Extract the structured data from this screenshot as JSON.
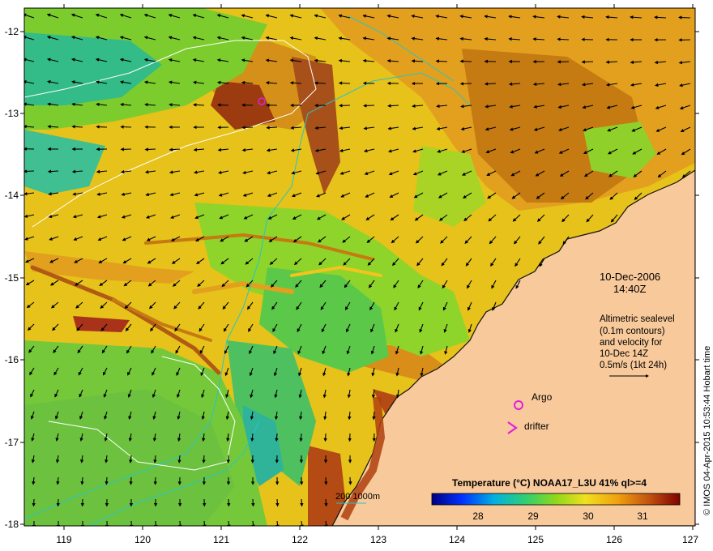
{
  "map": {
    "lon_ticks": [
      "119",
      "120",
      "121",
      "122",
      "123",
      "124",
      "125",
      "126",
      "127"
    ],
    "lat_ticks": [
      "-12",
      "-13",
      "-14",
      "-15",
      "-16",
      "-17",
      "-18"
    ],
    "date": "10-Dec-2006",
    "time": "14:40Z",
    "altimetry_note": [
      "Altimetric sealevel",
      "(0.1m contours)",
      "and velocity for",
      "10-Dec 14Z",
      "0.5m/s (1kt 24h)"
    ],
    "legend_argo": "Argo",
    "legend_drifter": "drifter",
    "bathy_label": "200  1000m",
    "colorbar_title": "Temperature (°C) NOAA17_L3U 41% ql>=4",
    "colorbar_ticks": [
      "28",
      "29",
      "30",
      "31"
    ],
    "credit": "© IMOS 04-Apr-2015 10:53:44 Hobart time",
    "colors": {
      "land": "#f9c99a",
      "warm": "#c87a10",
      "hot": "#8b1a0a",
      "mid": "#f0c41a",
      "cool": "#7bd12f",
      "cold": "#19b0b0",
      "argo": "#e020e0",
      "bathy_line": "#26c6c6"
    }
  }
}
